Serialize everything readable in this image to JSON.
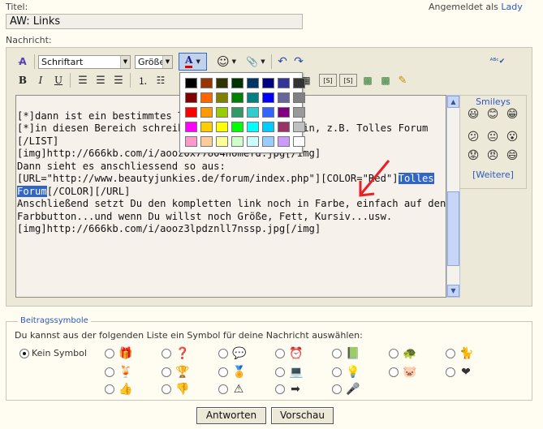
{
  "header": {
    "title_label": "Titel:",
    "logged_in_label": "Angemeldet als",
    "user": "Lady",
    "message_label": "Nachricht:"
  },
  "title_field": {
    "value": "AW: Links"
  },
  "toolbar": {
    "font_select": "Schriftart",
    "size_select": "Größe",
    "bold": "B",
    "italic": "I",
    "underline": "U"
  },
  "editor": {
    "lines": [
      "[*]dann ist ein bestimmtes Te",
      "[*]in diesen Bereich schreibe d               rein, z.B. Tolles Forum",
      "[/LIST]",
      "",
      "[img]http://666kb.com/i/aooz0x77804homefd.jpg[/img]",
      "",
      "Dann sieht es anschliessend so aus:",
      "",
      "[URL=\"http://www.beautyjunkies.de/forum/index.php\"][COLOR=\"Red\"]",
      "",
      "",
      "Anschließend setzt Du den kompletten link noch in Farbe, einfach auf den",
      "Farbbutton...und wenn Du willst noch Größe, Fett, Kursiv...usw.",
      "",
      "[img]http://666kb.com/i/aooz3lpdznll7nssp.jpg[/img]"
    ],
    "selected_1": "Tolles",
    "selected_2": "Forum",
    "after_selected": "[/COLOR][/URL]"
  },
  "smileys": {
    "title": "Smileys",
    "more_link": "[Weitere]",
    "faces": [
      "😃",
      "😊",
      "😁",
      "😕",
      "😐",
      "😮",
      "😟",
      "😠",
      "😄"
    ]
  },
  "color_palette": [
    "#000000",
    "#993300",
    "#333300",
    "#003300",
    "#003366",
    "#000080",
    "#333399",
    "#333333",
    "#800000",
    "#ff6600",
    "#808000",
    "#008000",
    "#008080",
    "#0000ff",
    "#666699",
    "#808080",
    "#ff0000",
    "#ff9900",
    "#99cc00",
    "#339966",
    "#33cccc",
    "#3366ff",
    "#800080",
    "#999999",
    "#ff00ff",
    "#ffcc00",
    "#ffff00",
    "#00ff00",
    "#00ffff",
    "#00ccff",
    "#993366",
    "#c0c0c0",
    "#ff99cc",
    "#ffcc99",
    "#ffff99",
    "#ccffcc",
    "#ccffff",
    "#99ccff",
    "#cc99ff",
    "#ffffff"
  ],
  "symbols": {
    "legend": "Beitragssymbole",
    "instructions": "Du kannst aus der folgenden Liste ein Symbol für deine Nachricht auswählen:",
    "none_label": "Kein Symbol",
    "row1": [
      "🎁",
      "❓",
      "💬",
      "⏰",
      "📗",
      "🐢",
      "🐈"
    ],
    "row2": [
      "🍹",
      "🏆",
      "🏅",
      "💻",
      "💡",
      "🐷",
      "❤"
    ],
    "row3": [
      "👍",
      "👎",
      "⚠",
      "➡",
      "🎤"
    ]
  },
  "buttons": {
    "submit": "Antworten",
    "preview": "Vorschau"
  },
  "colors": {
    "accent": "#3165c6",
    "arrow": "#e8202a"
  }
}
